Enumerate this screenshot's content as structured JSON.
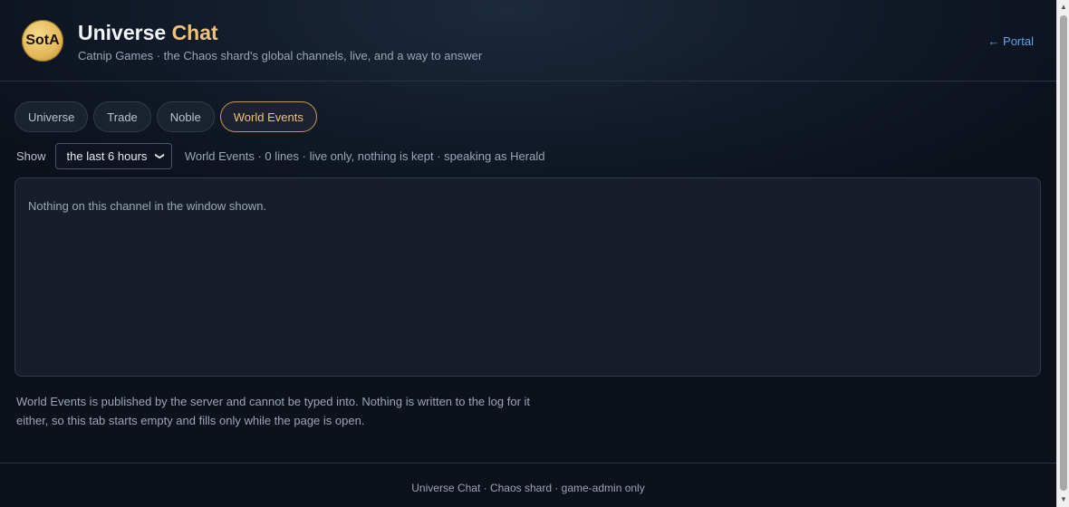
{
  "header": {
    "logo_text": "SotA",
    "title_main": "Universe",
    "title_accent": "Chat",
    "subtitle": "Catnip Games · the Chaos shard's global channels, live, and a way to answer",
    "portal_link": "← Portal"
  },
  "tabs": [
    {
      "label": "Universe",
      "active": false
    },
    {
      "label": "Trade",
      "active": false
    },
    {
      "label": "Noble",
      "active": false
    },
    {
      "label": "World Events",
      "active": true
    }
  ],
  "controls": {
    "show_label": "Show",
    "time_window": "the last 6 hours",
    "status": "World Events · 0 lines · live only, nothing is kept · speaking as Herald"
  },
  "log": {
    "empty_message": "Nothing on this channel in the window shown."
  },
  "note": "World Events is published by the server and cannot be typed into. Nothing is written to the log for it either, so this tab starts empty and fills only while the page is open.",
  "footer": {
    "text": "Universe Chat · Chaos shard · game-admin only"
  },
  "colors": {
    "accent": "#f0c27a",
    "link": "#5da3e8",
    "background": "#0c111b"
  }
}
